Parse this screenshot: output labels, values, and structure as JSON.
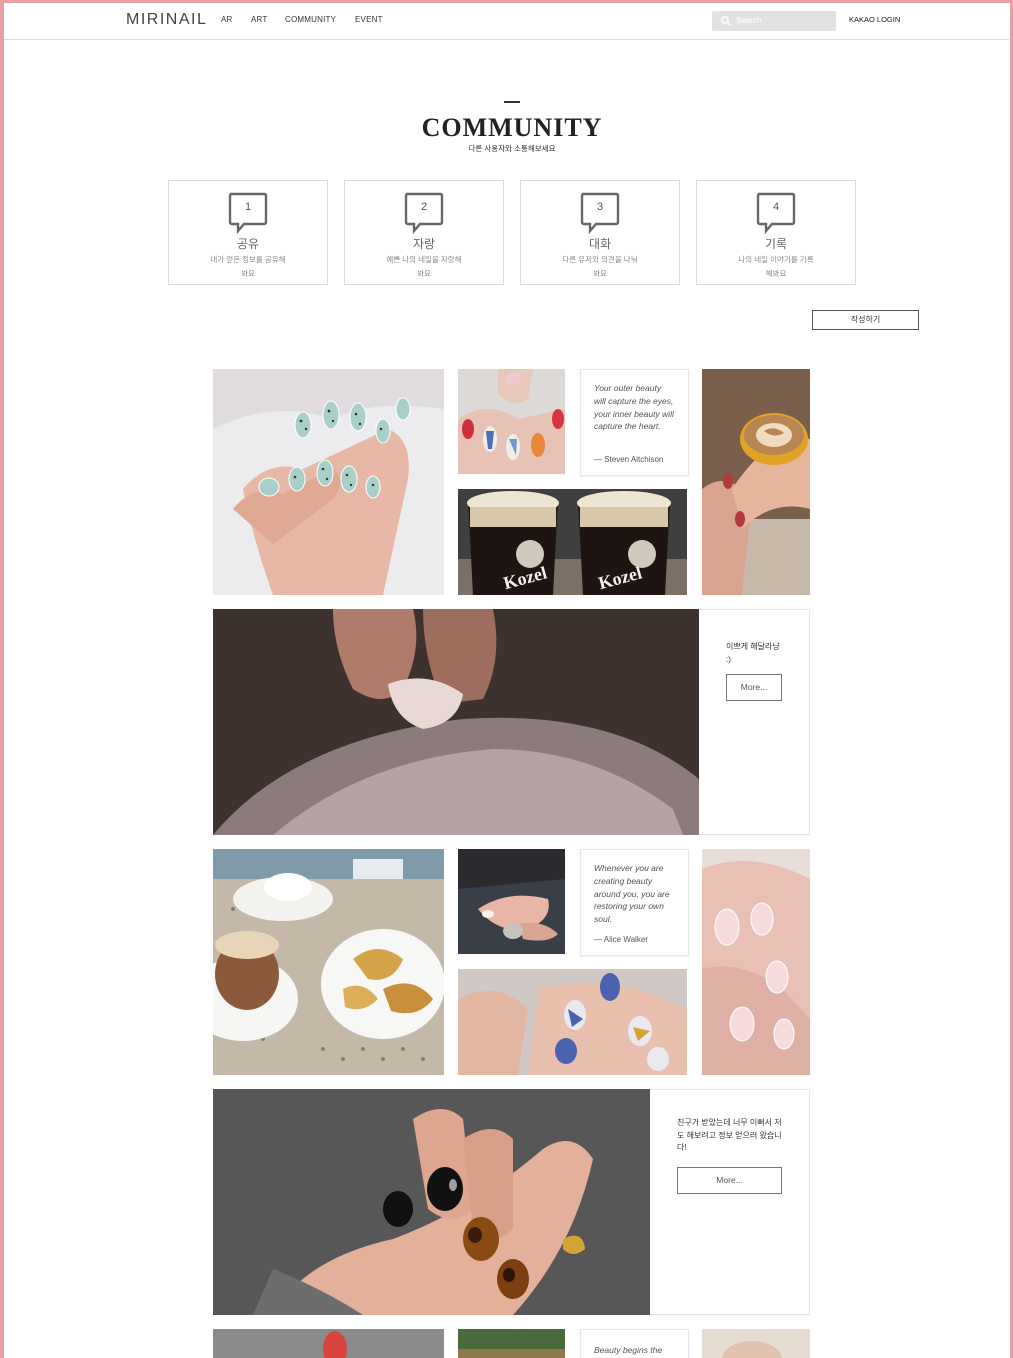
{
  "header": {
    "logo": "MIRINAIL",
    "nav": [
      "AR",
      "ART",
      "COMMUNITY",
      "EVENT"
    ],
    "search_placeholder": "Search",
    "login": "KAKAO LOGIN"
  },
  "page": {
    "title": "COMMUNITY",
    "subtitle": "다른 사용자와 소통해보세요"
  },
  "categories": [
    {
      "num": "1",
      "name": "공유",
      "desc": "내가 얻은 정보를 공유해봐요"
    },
    {
      "num": "2",
      "name": "자랑",
      "desc": "예쁜 나의 네일을 자랑해봐요"
    },
    {
      "num": "3",
      "name": "대화",
      "desc": "다른 유저와 의견을 나눠봐요"
    },
    {
      "num": "4",
      "name": "기록",
      "desc": "나의 네일 이야기를 기록해봐요"
    }
  ],
  "write_button": "작성하기",
  "quotes": [
    {
      "text": "Your outer beauty will capture the eyes, your inner beauty will capture the heart.",
      "author": "— Steven Aitchison"
    },
    {
      "text": "Whenever you are creating beauty around you, you are restoring your own soul.",
      "author": "— Alice Walker"
    },
    {
      "text": "Beauty begins the",
      "author": ""
    }
  ],
  "posts": [
    {
      "text": "이쁘게 해달라냥 :)",
      "more": "More..."
    },
    {
      "text": "친구가 받았는데 너무 이뻐서 저도 해보려고 정보 얻으러 왔습니다!",
      "more": "More..."
    }
  ],
  "photo_labels": [
    "Kozel",
    "Kozel"
  ],
  "colors": {
    "frame": "#e8a0a4",
    "accent_dark": "#222222"
  }
}
